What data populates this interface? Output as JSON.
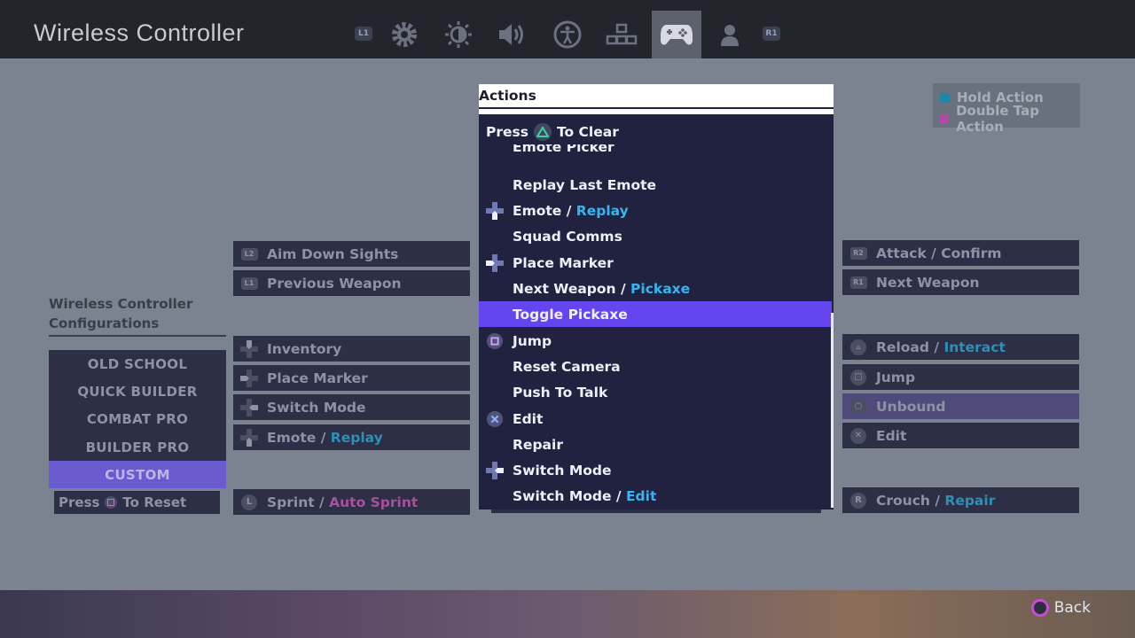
{
  "header": {
    "title": "Wireless Controller",
    "left_bumper": "L1",
    "right_bumper": "R1",
    "tabs": [
      {
        "icon": "gear-icon"
      },
      {
        "icon": "brightness-icon"
      },
      {
        "icon": "speaker-icon"
      },
      {
        "icon": "accessibility-icon"
      },
      {
        "icon": "hud-icon"
      },
      {
        "icon": "gamepad-icon",
        "active": true
      },
      {
        "icon": "account-icon"
      }
    ]
  },
  "legend": {
    "hold": {
      "label": "Hold Action",
      "color": "#1f86a8"
    },
    "double_tap": {
      "label": "Double Tap Action",
      "color": "#b44aa6"
    }
  },
  "configs": {
    "heading": "Wireless Controller Configurations",
    "items": [
      "OLD SCHOOL",
      "QUICK BUILDER",
      "COMBAT PRO",
      "BUILDER PRO",
      "CUSTOM"
    ],
    "selected": "CUSTOM",
    "reset_press": "Press",
    "reset_text": "To Reset"
  },
  "left_bindings": [
    {
      "button": "L2",
      "action": "Aim Down Sights",
      "alt": ""
    },
    {
      "button": "L1",
      "action": "Previous Weapon",
      "alt": ""
    },
    {
      "button": "dpad-up",
      "action": "Inventory",
      "alt": ""
    },
    {
      "button": "dpad-left",
      "action": "Place Marker",
      "alt": ""
    },
    {
      "button": "dpad-right",
      "action": "Switch Mode",
      "alt": ""
    },
    {
      "button": "dpad-down",
      "action": "Emote /",
      "alt": "Replay",
      "alt_type": "hold"
    },
    {
      "button": "L3",
      "action": "Sprint /",
      "alt": "Auto Sprint",
      "alt_type": "double"
    }
  ],
  "right_bindings": [
    {
      "button": "R2",
      "action": "Attack / Confirm",
      "alt": ""
    },
    {
      "button": "R1",
      "action": "Next Weapon",
      "alt": ""
    },
    {
      "button": "triangle",
      "action": "Reload /",
      "alt": "Interact",
      "alt_type": "hold"
    },
    {
      "button": "square",
      "action": "Jump",
      "alt": ""
    },
    {
      "button": "circle",
      "action": "Unbound",
      "alt": "",
      "highlighted": true
    },
    {
      "button": "cross",
      "action": "Edit",
      "alt": ""
    },
    {
      "button": "R3",
      "action": "Crouch /",
      "alt": "Repair",
      "alt_type": "hold"
    }
  ],
  "actions_panel": {
    "title": "Actions",
    "press": "Press",
    "clear": "To Clear",
    "items": [
      {
        "label": "Emote Picker",
        "alt": "",
        "glyph": ""
      },
      {
        "label": "Replay Last Emote",
        "alt": "",
        "glyph": ""
      },
      {
        "label": "Emote /",
        "alt": "Replay",
        "glyph": "dpad-down"
      },
      {
        "label": "Squad Comms",
        "alt": "",
        "glyph": ""
      },
      {
        "label": "Place Marker",
        "alt": "",
        "glyph": "dpad-left"
      },
      {
        "label": "Next Weapon /",
        "alt": "Pickaxe",
        "glyph": ""
      },
      {
        "label": "Toggle Pickaxe",
        "alt": "",
        "glyph": "",
        "selected": true
      },
      {
        "label": "Jump",
        "alt": "",
        "glyph": "square"
      },
      {
        "label": "Reset Camera",
        "alt": "",
        "glyph": ""
      },
      {
        "label": "Push To Talk",
        "alt": "",
        "glyph": ""
      },
      {
        "label": "Edit",
        "alt": "",
        "glyph": "cross"
      },
      {
        "label": "Repair",
        "alt": "",
        "glyph": ""
      },
      {
        "label": "Switch Mode",
        "alt": "",
        "glyph": "dpad-right"
      },
      {
        "label": "Switch Mode /",
        "alt": "Edit",
        "glyph": ""
      }
    ]
  },
  "footer": {
    "back": "Back"
  }
}
